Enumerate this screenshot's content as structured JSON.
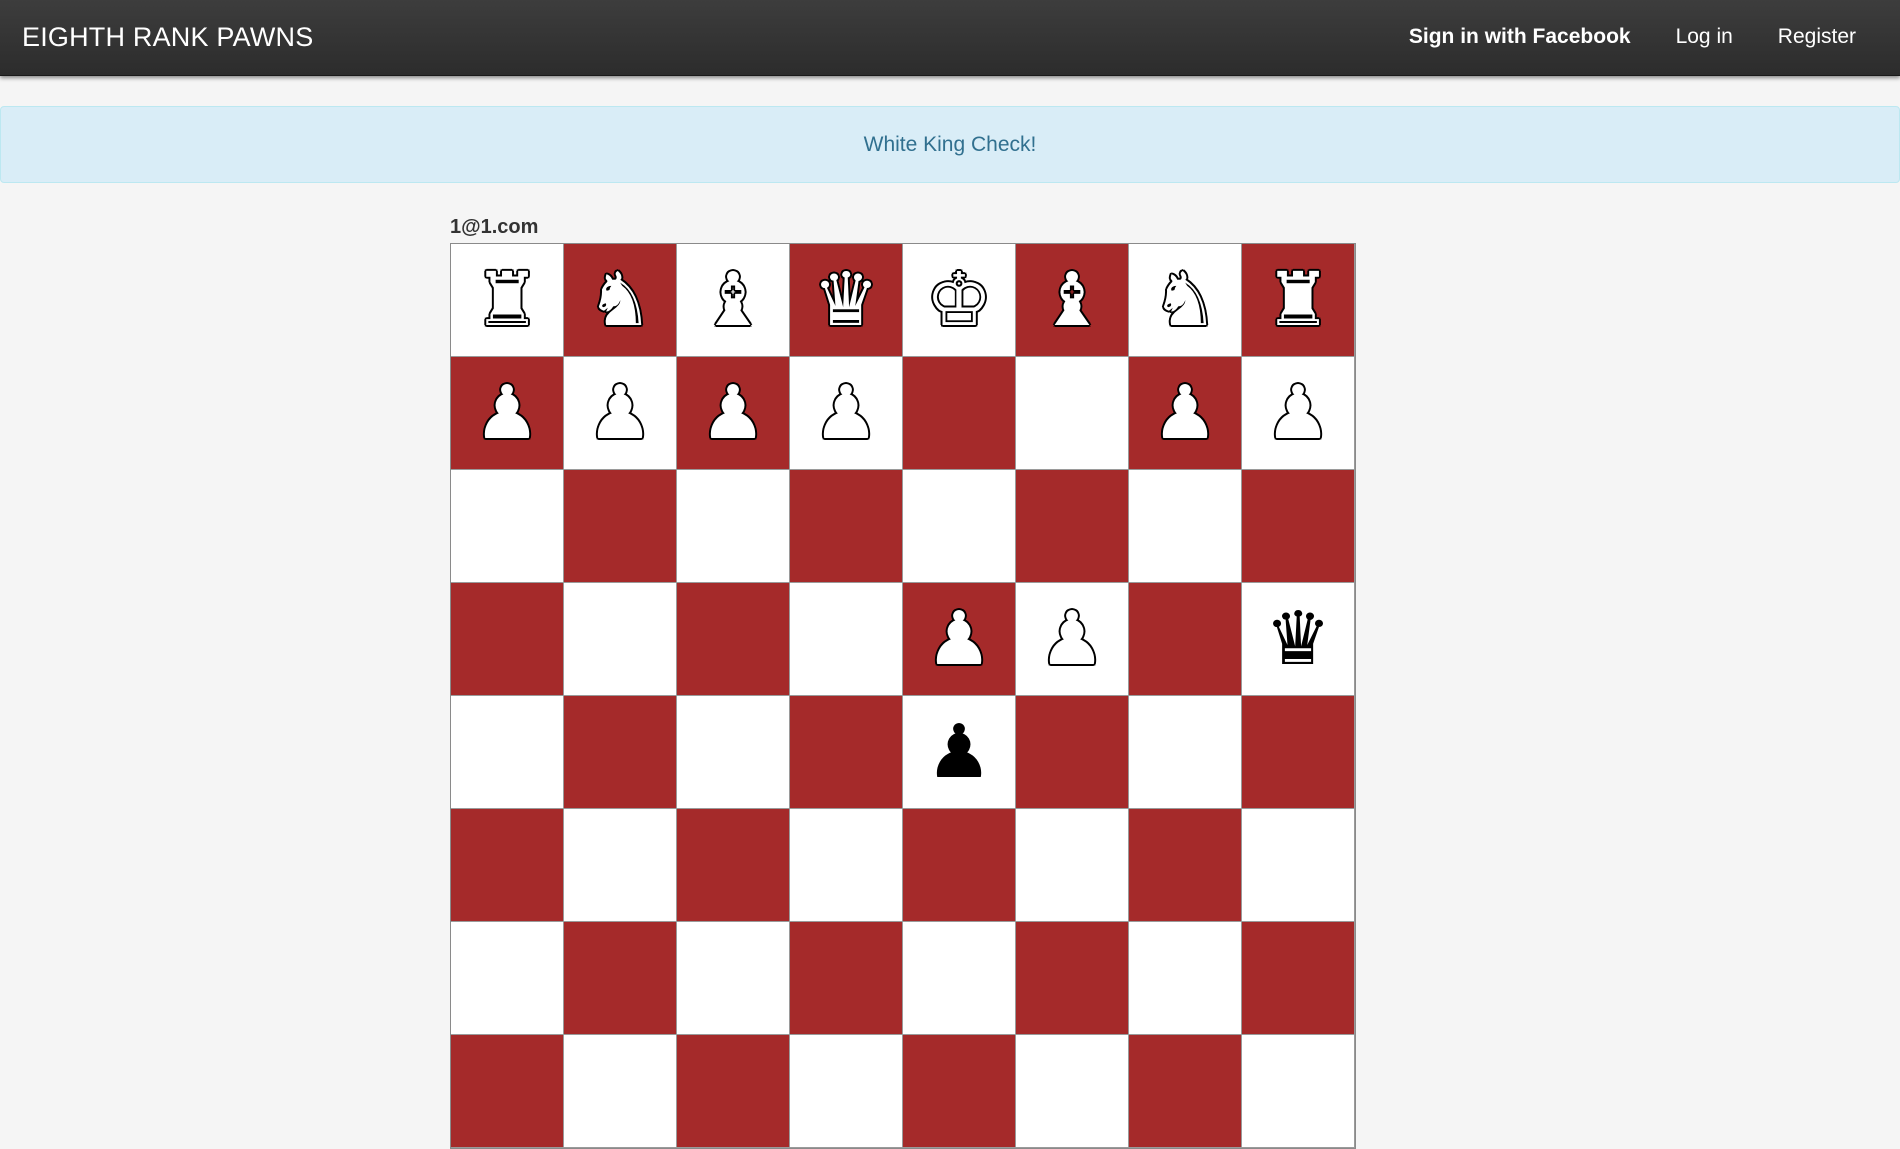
{
  "navbar": {
    "brand": "EIGHTH RANK PAWNS",
    "facebook_label": "Sign in with Facebook",
    "login_label": "Log in",
    "register_label": "Register"
  },
  "alert": {
    "message": "White King Check!"
  },
  "game": {
    "player": "1@1.com",
    "colors": {
      "light_square": "#ffffff",
      "dark_square": "#a52a2a"
    },
    "visible_ranks": [
      [
        "white-rook",
        "white-knight",
        "white-bishop",
        "white-queen",
        "white-king",
        "white-bishop",
        "white-knight",
        "white-rook"
      ],
      [
        "white-pawn",
        "white-pawn",
        "white-pawn",
        "white-pawn",
        "",
        "",
        "white-pawn",
        "white-pawn"
      ],
      [
        "",
        "",
        "",
        "",
        "",
        "",
        "",
        ""
      ],
      [
        "",
        "",
        "",
        "",
        "white-pawn",
        "white-pawn",
        "",
        "black-queen"
      ],
      [
        "",
        "",
        "",
        "",
        "black-pawn",
        "",
        "",
        ""
      ],
      [
        "",
        "",
        "",
        "",
        "",
        "",
        "",
        ""
      ]
    ]
  }
}
